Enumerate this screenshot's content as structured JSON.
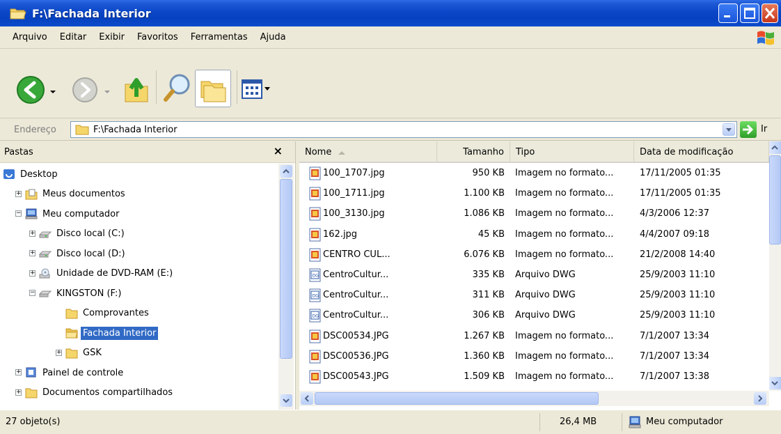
{
  "window": {
    "title": "F:\\Fachada Interior"
  },
  "menu": {
    "items": [
      {
        "label": "Arquivo",
        "key": "A"
      },
      {
        "label": "Editar",
        "key": "d"
      },
      {
        "label": "Exibir",
        "key": "x"
      },
      {
        "label": "Favoritos",
        "key": "F"
      },
      {
        "label": "Ferramentas",
        "key": "e"
      },
      {
        "label": "Ajuda",
        "key": "u"
      }
    ]
  },
  "address": {
    "label": "Endereço",
    "path": "F:\\Fachada Interior",
    "go_label": "Ir"
  },
  "folders": {
    "title": "Pastas",
    "close": "×",
    "tree": [
      {
        "label": "Desktop",
        "icon": "desktop-icon",
        "depth": 0,
        "expander": ""
      },
      {
        "label": "Meus documentos",
        "icon": "my-documents-icon",
        "depth": 1,
        "expander": "+"
      },
      {
        "label": "Meu computador",
        "icon": "my-computer-icon",
        "depth": 1,
        "expander": "-"
      },
      {
        "label": "Disco local (C:)",
        "icon": "hard-disk-icon",
        "depth": 2,
        "expander": "+"
      },
      {
        "label": "Disco local (D:)",
        "icon": "hard-disk-icon",
        "depth": 2,
        "expander": "+"
      },
      {
        "label": "Unidade de DVD-RAM (E:)",
        "icon": "dvd-drive-icon",
        "depth": 2,
        "expander": "+"
      },
      {
        "label": "KINGSTON (F:)",
        "icon": "removable-drive-icon",
        "depth": 2,
        "expander": "-"
      },
      {
        "label": "Comprovantes",
        "icon": "folder-icon",
        "depth": 3,
        "expander": ""
      },
      {
        "label": "Fachada Interior",
        "icon": "folder-open-icon",
        "depth": 3,
        "expander": "",
        "selected": true
      },
      {
        "label": "GSK",
        "icon": "folder-icon",
        "depth": 3,
        "expander": "+"
      },
      {
        "label": "Painel de controle",
        "icon": "control-panel-icon",
        "depth": 1,
        "expander": "+"
      },
      {
        "label": "Documentos compartilhados",
        "icon": "folder-icon",
        "depth": 1,
        "expander": "+"
      }
    ]
  },
  "filelist": {
    "columns": [
      "Nome",
      "Tamanho",
      "Tipo",
      "Data de modificação"
    ],
    "rows": [
      {
        "name": "100_1707.jpg",
        "size": "950 KB",
        "type": "Imagem no formato...",
        "date": "17/11/2005 01:35",
        "icon": "jpg-file-icon"
      },
      {
        "name": "100_1711.jpg",
        "size": "1.100 KB",
        "type": "Imagem no formato...",
        "date": "17/11/2005 01:35",
        "icon": "jpg-file-icon"
      },
      {
        "name": "100_3130.jpg",
        "size": "1.086 KB",
        "type": "Imagem no formato...",
        "date": "4/3/2006 12:37",
        "icon": "jpg-file-icon"
      },
      {
        "name": "162.jpg",
        "size": "45 KB",
        "type": "Imagem no formato...",
        "date": "4/4/2007 09:18",
        "icon": "jpg-file-icon"
      },
      {
        "name": "CENTRO CUL...",
        "size": "6.076 KB",
        "type": "Imagem no formato...",
        "date": "21/2/2008 14:40",
        "icon": "jpg-file-icon"
      },
      {
        "name": "CentroCultur...",
        "size": "335 KB",
        "type": "Arquivo DWG",
        "date": "25/9/2003 11:10",
        "icon": "dwg-file-icon"
      },
      {
        "name": "CentroCultur...",
        "size": "311 KB",
        "type": "Arquivo DWG",
        "date": "25/9/2003 11:10",
        "icon": "dwg-file-icon"
      },
      {
        "name": "CentroCultur...",
        "size": "306 KB",
        "type": "Arquivo DWG",
        "date": "25/9/2003 11:10",
        "icon": "dwg-file-icon"
      },
      {
        "name": "DSC00534.JPG",
        "size": "1.267 KB",
        "type": "Imagem no formato...",
        "date": "7/1/2007 13:34",
        "icon": "jpg-file-icon"
      },
      {
        "name": "DSC00536.JPG",
        "size": "1.360 KB",
        "type": "Imagem no formato...",
        "date": "7/1/2007 13:34",
        "icon": "jpg-file-icon"
      },
      {
        "name": "DSC00543.JPG",
        "size": "1.509 KB",
        "type": "Imagem no formato...",
        "date": "7/1/2007 13:38",
        "icon": "jpg-file-icon"
      }
    ]
  },
  "status": {
    "objects": "27 objeto(s)",
    "size": "26,4 MB",
    "location": "Meu computador"
  }
}
